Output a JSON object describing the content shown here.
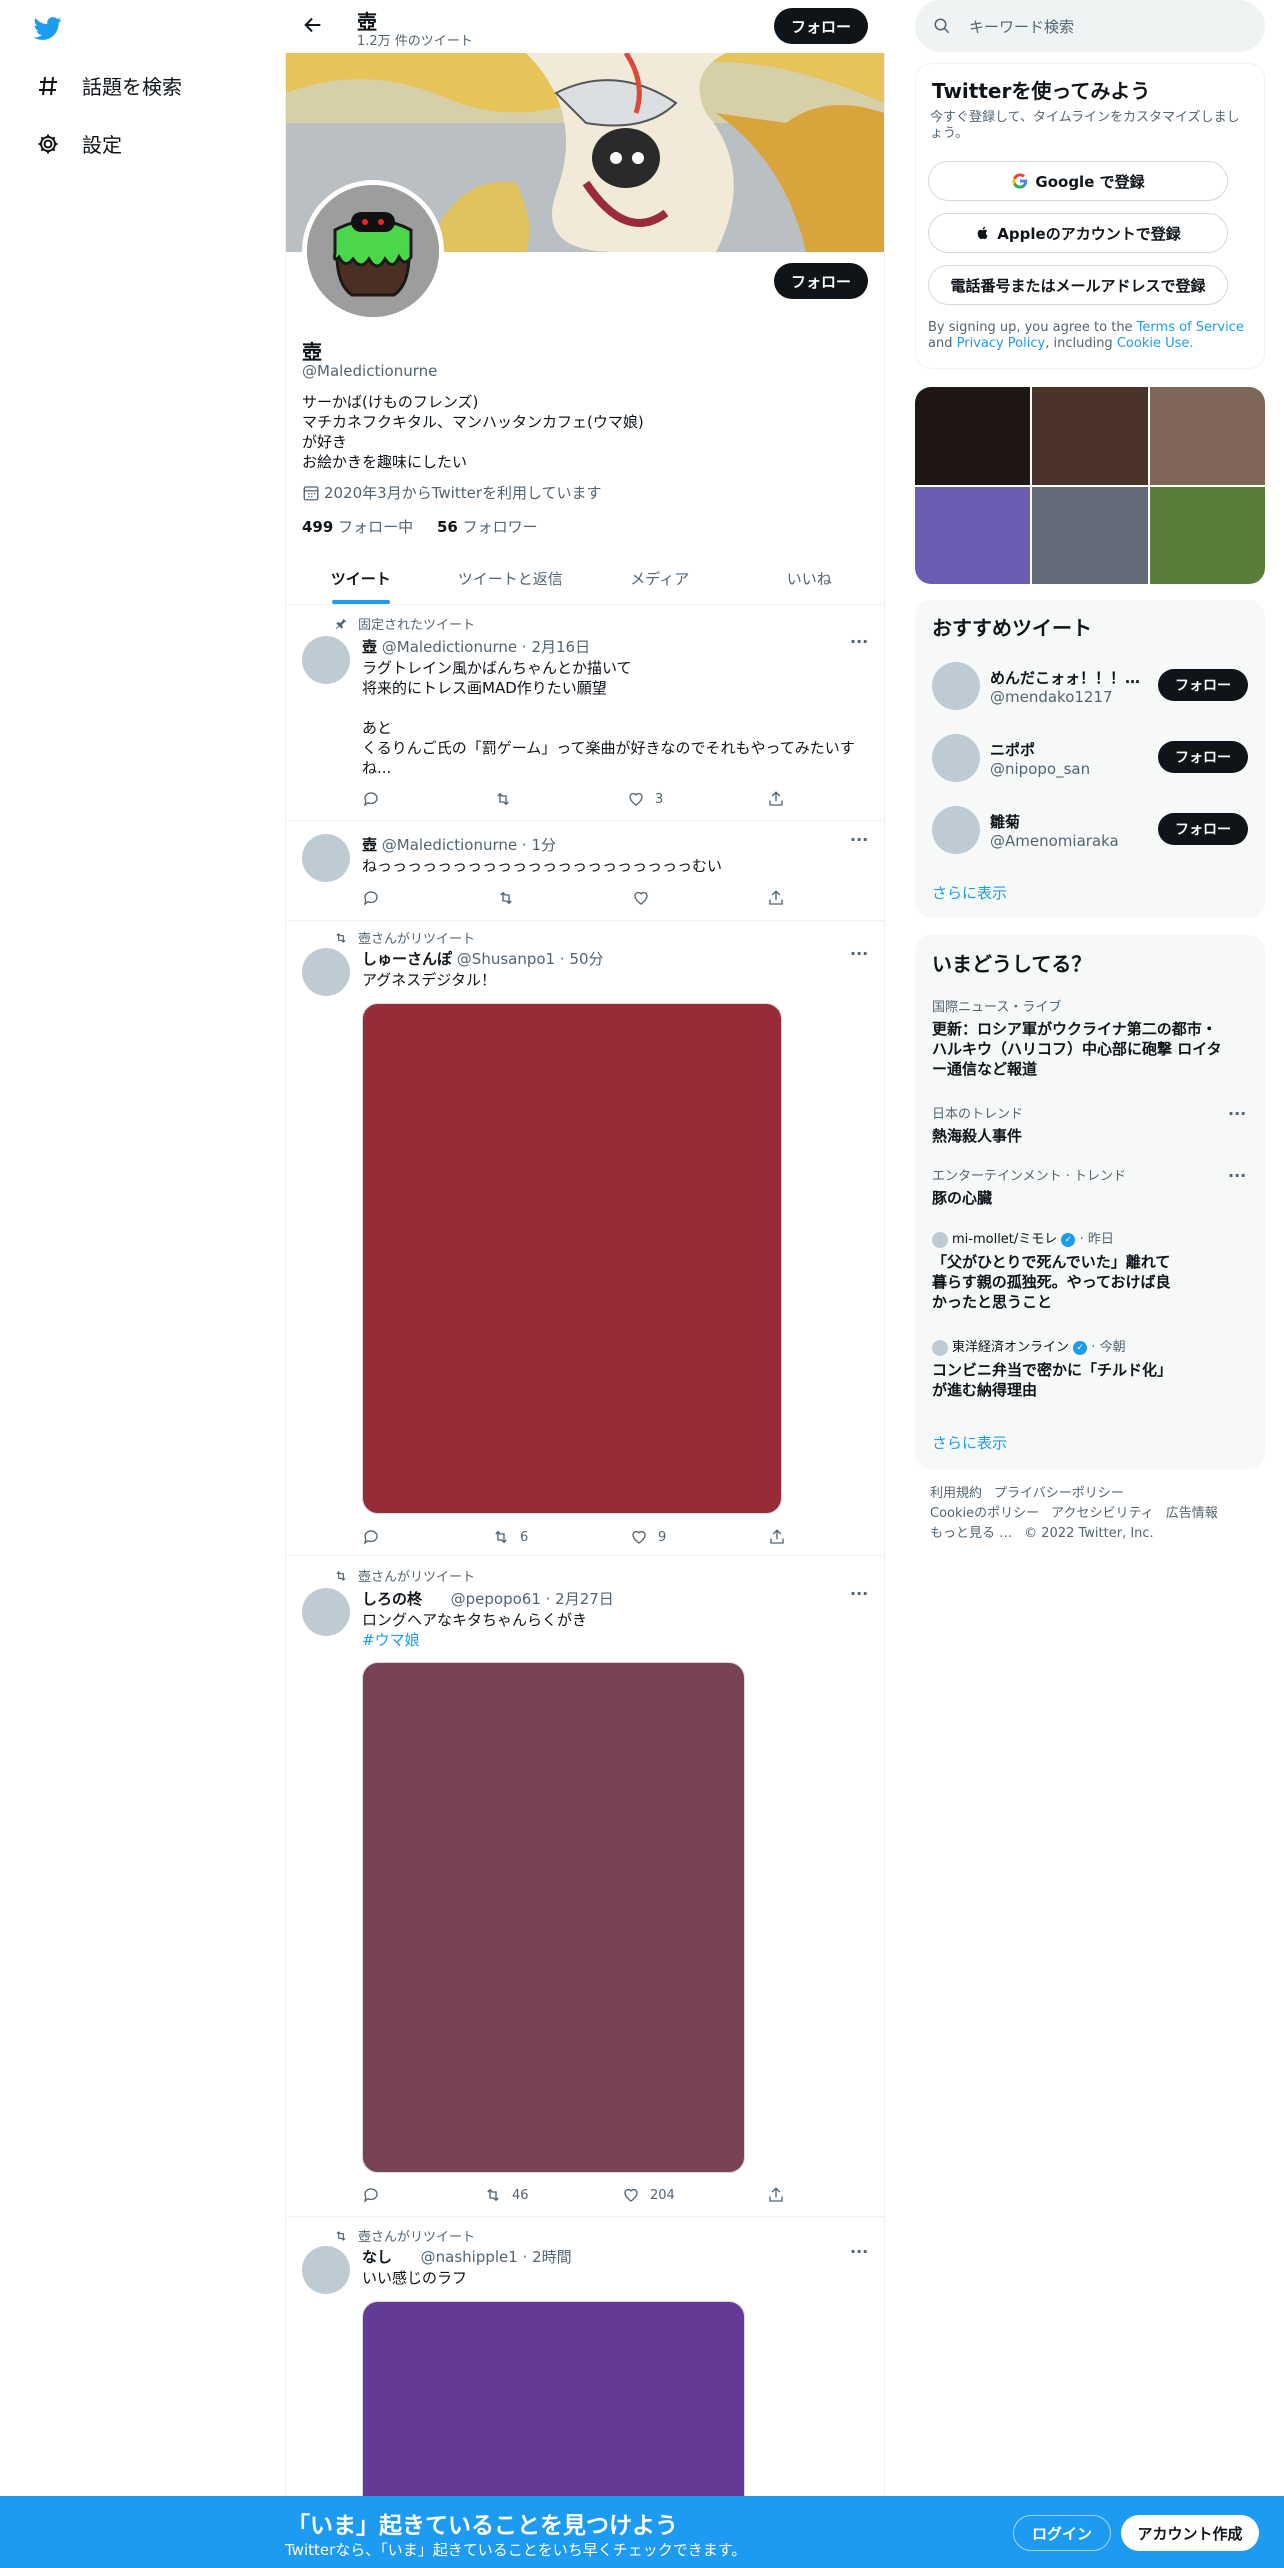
{
  "nav": {
    "items": [
      {
        "label": "話題を検索",
        "icon": "hashtag-icon"
      },
      {
        "label": "設定",
        "icon": "gear-icon"
      }
    ]
  },
  "header": {
    "title": "壺",
    "tweet_count": "1.2万 件のツイート",
    "follow_label": "フォロー"
  },
  "profile": {
    "name": "壺",
    "handle": "@Maledictionurne",
    "bio": "サーかば(けものフレンズ)\nマチカネフクキタル、マンハッタンカフェ(ウマ娘)\nが好き\nお絵かきを趣味にしたい",
    "joined": "2020年3月からTwitterを利用しています",
    "following_count": "499",
    "following_label": "フォロー中",
    "followers_count": "56",
    "followers_label": "フォロワー",
    "follow_label": "フォロー"
  },
  "tabs": [
    "ツイート",
    "ツイートと返信",
    "メディア",
    "いいね"
  ],
  "tweets": [
    {
      "context": "固定されたツイート",
      "name": "壺",
      "handle": "@Maledictionurne",
      "time": "2月16日",
      "text": "ラグトレイン風かばんちゃんとか描いて\n将来的にトレス画MAD作りたい願望\n\nあと\nくるりんご氏の「罰ゲーム」って楽曲が好きなのでそれもやってみたいす\nね...",
      "reply": "",
      "retweet": "",
      "like": "3"
    },
    {
      "context": "",
      "name": "壺",
      "handle": "@Maledictionurne",
      "time": "1分",
      "text": "ねっっっっっっっっっっっっっっっっっっっっっむい",
      "reply": "",
      "retweet": "",
      "like": ""
    },
    {
      "context": "壺さんがリツイート",
      "name": "しゅーさんぽ",
      "handle": "@Shusanpo1",
      "time": "50分",
      "text": "アグネスデジタル！",
      "media_color": "#982b38",
      "reply": "",
      "retweet": "6",
      "like": "9"
    },
    {
      "context": "壺さんがリツイート",
      "name": "しろの柊",
      "handle": "@pepopo61",
      "time": "2月27日",
      "text": "ロングヘアなキタちゃんらくがき",
      "hashtag": "#ウマ娘",
      "media_color": "#7a4256",
      "reply": "",
      "retweet": "46",
      "like": "204"
    },
    {
      "context": "壺さんがリツイート",
      "name": "なし",
      "handle": "@nashipple1",
      "time": "2時間",
      "text": "いい感じのラフ",
      "media_color": "#633a95"
    }
  ],
  "search": {
    "placeholder": "キーワード検索"
  },
  "signup": {
    "title": "Twitterを使ってみよう",
    "subtitle": "今すぐ登録して、タイムラインをカスタマイズしましょう。",
    "google": "Google で登録",
    "apple": "Appleのアカウントで登録",
    "phone": "電話番号またはメールアドレスで登録",
    "legal_1": "By signing up, you agree to the",
    "terms": "Terms of Service",
    "and": "and",
    "privacy": "Privacy Policy",
    "including": ", including",
    "cookie": "Cookie Use."
  },
  "photo_colors": [
    "#1f1616",
    "#4a3329",
    "#806659",
    "#6b5db3",
    "#646a77",
    "#5a7d3b"
  ],
  "recommend": {
    "title": "おすすめツイート",
    "users": [
      {
        "name": "めんだこォォ！！！…",
        "handle": "@mendako1217"
      },
      {
        "name": "ニポポ",
        "handle": "@nipopo_san"
      },
      {
        "name": "雛菊",
        "handle": "@Amenomiaraka"
      }
    ],
    "follow_label": "フォロー",
    "more": "さらに表示"
  },
  "trends": {
    "title": "いまどうしてる？",
    "items": [
      {
        "category": "国際ニュース・ライブ",
        "title": "更新：ロシア軍がウクライナ第二の都市・ハルキウ（ハリコフ）中心部に砲撃 ロイター通信など報道"
      },
      {
        "category": "日本のトレンド",
        "title": "熱海殺人事件"
      },
      {
        "category": "エンターテインメント · トレンド",
        "title": "豚の心臓"
      },
      {
        "source": "mi-mollet/ミモレ",
        "time": "昨日",
        "title": "「父がひとりで死んでいた」離れて暮らす親の孤独死。やっておけば良かったと思うこと"
      },
      {
        "source": "東洋経済オンライン",
        "time": "今朝",
        "title": "コンビニ弁当で密かに「チルド化」が進む納得理由"
      }
    ],
    "more": "さらに表示"
  },
  "footer": {
    "links": [
      "利用規約",
      "プライバシーポリシー",
      "Cookieのポリシー",
      "アクセシビリティ",
      "広告情報",
      "もっと見る …"
    ],
    "copyright": "© 2022 Twitter, Inc."
  },
  "bottombar": {
    "title": "「いま」起きていることを見つけよう",
    "subtitle": "Twitterなら、「いま」起きていることをいち早くチェックできます。",
    "login": "ログイン",
    "signup": "アカウント作成"
  },
  "colors": {
    "accent": "#1d9bf0",
    "text": "#0f1419",
    "muted": "#536471"
  }
}
